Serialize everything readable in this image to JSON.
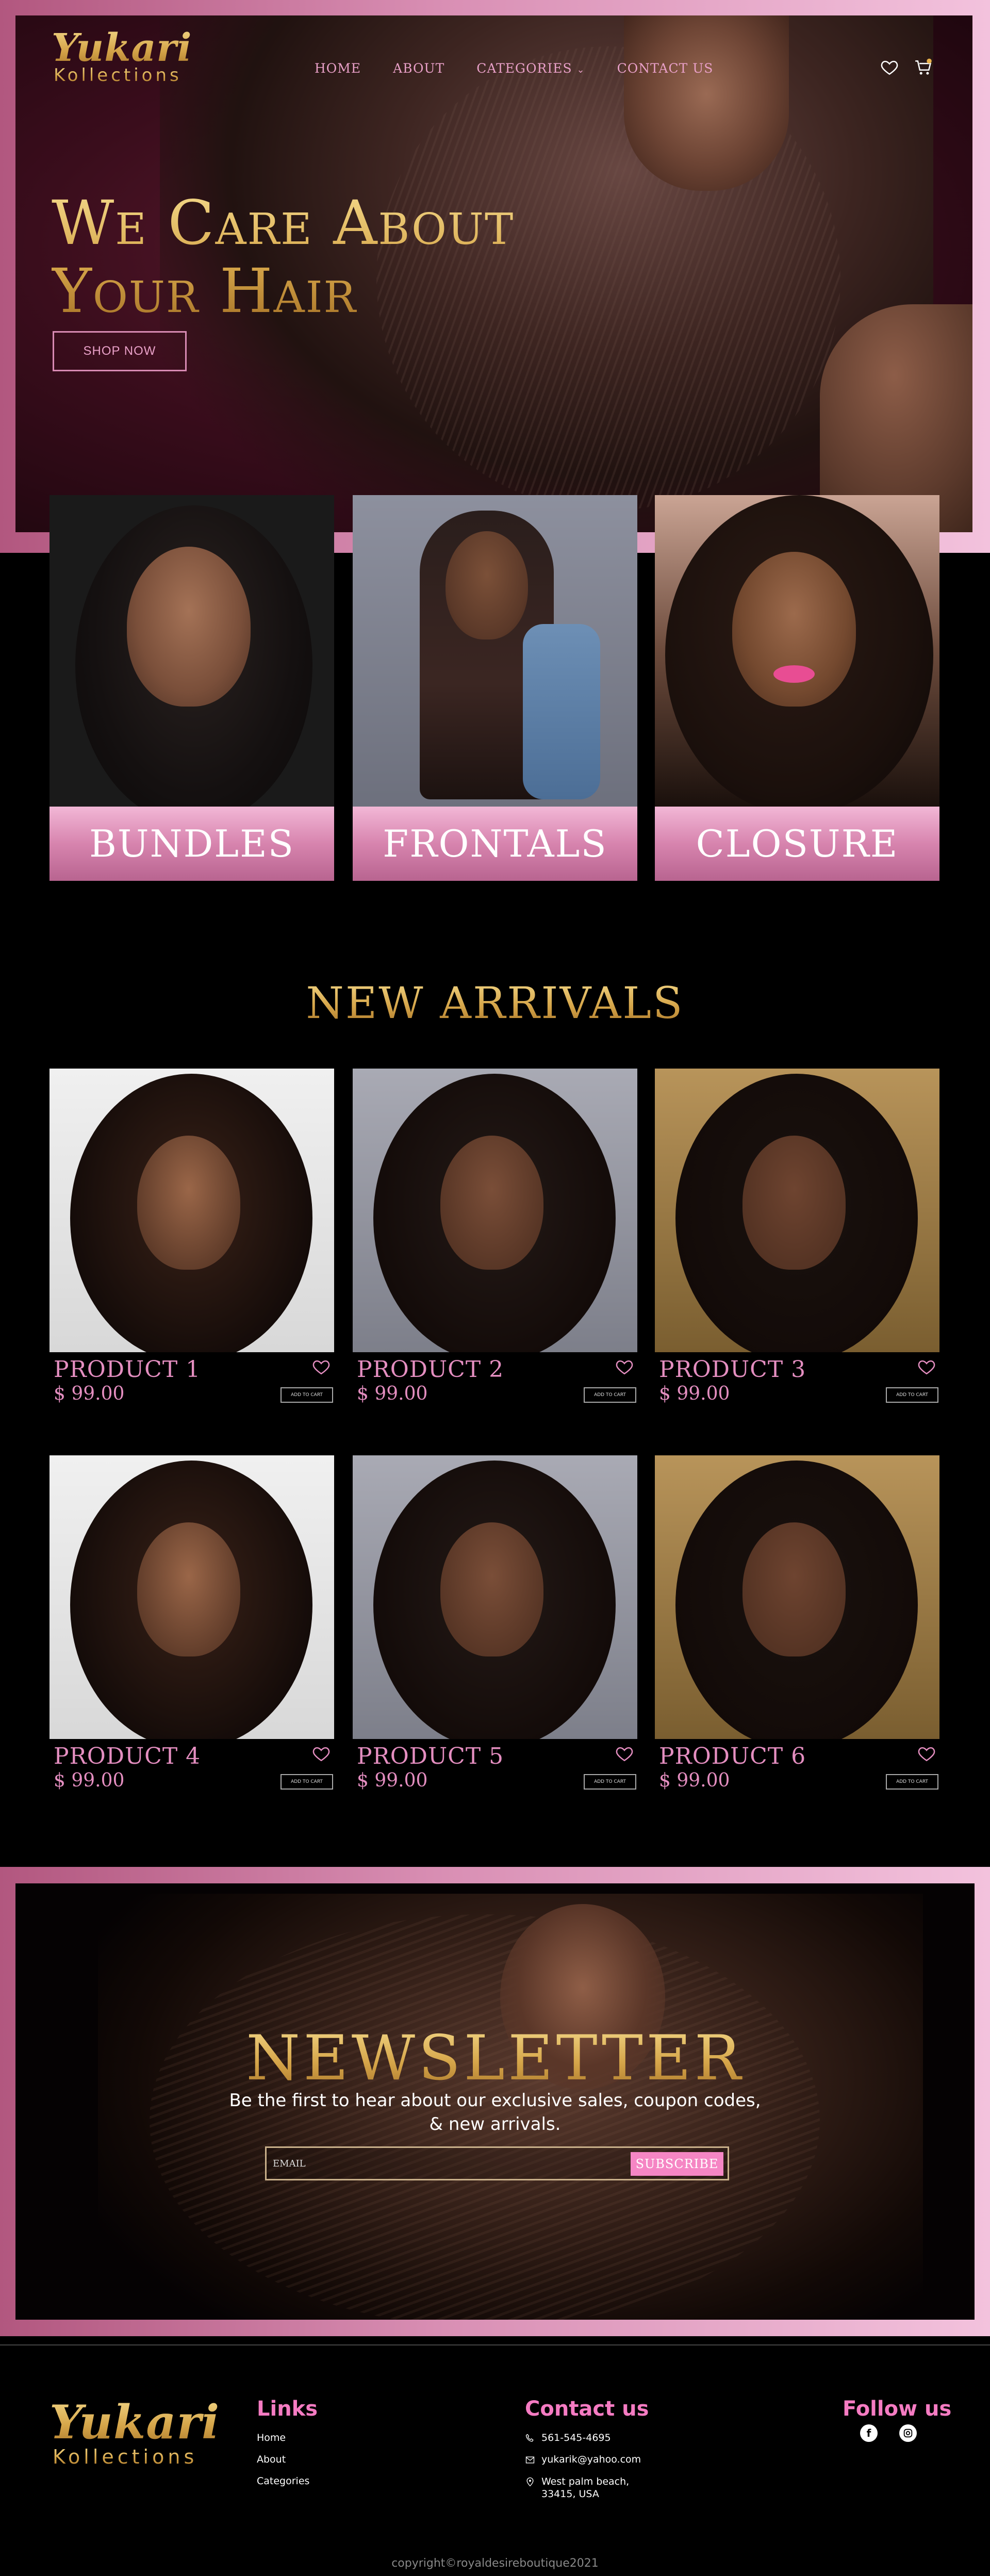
{
  "brand": {
    "script": "Yukari",
    "sub": "Kollections"
  },
  "nav": {
    "items": [
      "HOME",
      "ABOUT",
      "CATEGORIES",
      "CONTACT US"
    ],
    "categories_chevron": "⌄"
  },
  "hero": {
    "title_line1": "We Care About",
    "title_line2": "Your Hair",
    "cta": "SHOP NOW"
  },
  "categories": [
    {
      "label": "BUNDLES"
    },
    {
      "label": "FRONTALS"
    },
    {
      "label": "CLOSURE"
    }
  ],
  "new_arrivals": {
    "title": "NEW ARRIVALS",
    "cart_label": "ADD TO CART",
    "products": [
      {
        "name": "PRODUCT 1",
        "price": "$ 99.00"
      },
      {
        "name": "PRODUCT 2",
        "price": "$ 99.00"
      },
      {
        "name": "PRODUCT 3",
        "price": "$ 99.00"
      },
      {
        "name": "PRODUCT 4",
        "price": "$ 99.00"
      },
      {
        "name": "PRODUCT 5",
        "price": "$ 99.00"
      },
      {
        "name": "PRODUCT 6",
        "price": "$ 99.00"
      }
    ]
  },
  "newsletter": {
    "title": "NEWSLETTER",
    "text_line1": "Be the first to hear about our  exclusive sales, coupon codes,",
    "text_line2": "& new arrivals.",
    "placeholder": "EMAIL",
    "button": "SUBSCRIBE"
  },
  "footer": {
    "links_title": "Links",
    "links": [
      "Home",
      "About",
      "Categories"
    ],
    "contact_title": "Contact us",
    "phone": "561-545-4695",
    "email": "yukarik@yahoo.com",
    "address_line1": "West palm beach,",
    "address_line2": "33415, USA",
    "follow_title": "Follow us",
    "copyright": "copyright©royaldesireboutique2021"
  },
  "colors": {
    "accent_pink": "#e48ec0",
    "gold": "#d6a64a",
    "frame_pink": "#d98fb4"
  }
}
